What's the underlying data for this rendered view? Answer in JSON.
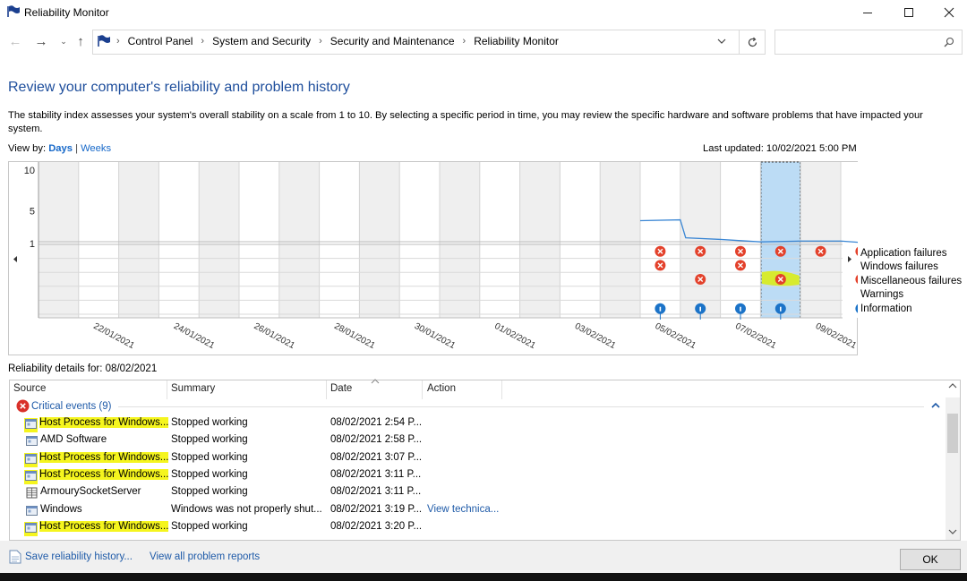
{
  "window": {
    "title": "Reliability Monitor"
  },
  "address": {
    "breadcrumbs": [
      "Control Panel",
      "System and Security",
      "Security and Maintenance",
      "Reliability Monitor"
    ],
    "search_placeholder": ""
  },
  "page": {
    "heading": "Review your computer's reliability and problem history",
    "description": "The stability index assesses your system's overall stability on a scale from 1 to 10. By selecting a specific period in time, you may review the specific hardware and software problems that have impacted your system.",
    "view_by_label": "View by:",
    "view_days": "Days",
    "view_separator": "|",
    "view_weeks": "Weeks",
    "last_updated": "Last updated: 10/02/2021 5:00 PM"
  },
  "chart_data": {
    "type": "line",
    "y_ticks": [
      "10",
      "5",
      "1"
    ],
    "ylim": [
      1,
      10
    ],
    "date_labels": [
      "22/01/2021",
      "24/01/2021",
      "26/01/2021",
      "28/01/2021",
      "30/01/2021",
      "01/02/2021",
      "03/02/2021",
      "05/02/2021",
      "07/02/2021",
      "09/02/2021"
    ],
    "days": [
      "21/01",
      "22/01",
      "23/01",
      "24/01",
      "25/01",
      "26/01",
      "27/01",
      "28/01",
      "29/01",
      "30/01",
      "31/01",
      "01/02",
      "02/02",
      "03/02",
      "04/02",
      "05/02",
      "06/02",
      "07/02",
      "08/02",
      "09/02"
    ],
    "selected_day": "08/02",
    "stability_index": [
      {
        "day": "05/02",
        "value": 3.8
      },
      {
        "day": "06/02",
        "value": 3.9
      },
      {
        "day": "06/02",
        "value": 1.7
      },
      {
        "day": "07/02",
        "value": 1.5
      },
      {
        "day": "08/02",
        "value": 1.2
      },
      {
        "day": "09/02",
        "value": 1.3
      },
      {
        "day": "10/02",
        "value": 1.3
      }
    ],
    "event_rows": [
      "Application failures",
      "Windows failures",
      "Miscellaneous failures",
      "Warnings",
      "Information"
    ],
    "events": {
      "Application failures": [
        "05/02",
        "06/02",
        "07/02",
        "08/02",
        "09/02",
        "10/02"
      ],
      "Windows failures": [
        "05/02",
        "07/02"
      ],
      "Miscellaneous failures": [
        "06/02",
        "08/02",
        "10/02"
      ],
      "Warnings": [],
      "Information": [
        "05/02",
        "06/02",
        "07/02",
        "08/02",
        "10/02"
      ]
    },
    "colors": {
      "line": "#3a86d4",
      "error": "#e3412b",
      "info": "#1b73c8",
      "selected": "#bcdcf5",
      "weekend": "#efefef",
      "highlight": "#d9ec1a"
    }
  },
  "details": {
    "label": "Reliability details for: 08/02/2021",
    "columns": [
      "Source",
      "Summary",
      "Date",
      "Action"
    ],
    "group": "Critical events (9)",
    "rows": [
      {
        "source": "Host Process for Windows...",
        "summary": "Stopped working",
        "date": "08/02/2021 2:54 P...",
        "action": "",
        "icon": "app-window-icon",
        "highlighted": true
      },
      {
        "source": "AMD Software",
        "summary": "Stopped working",
        "date": "08/02/2021 2:58 P...",
        "action": "",
        "icon": "app-window-icon",
        "highlighted": false
      },
      {
        "source": "Host Process for Windows...",
        "summary": "Stopped working",
        "date": "08/02/2021 3:07 P...",
        "action": "",
        "icon": "app-window-icon",
        "highlighted": true
      },
      {
        "source": "Host Process for Windows...",
        "summary": "Stopped working",
        "date": "08/02/2021 3:11 P...",
        "action": "",
        "icon": "app-window-icon",
        "highlighted": true
      },
      {
        "source": "ArmourySocketServer",
        "summary": "Stopped working",
        "date": "08/02/2021 3:11 P...",
        "action": "",
        "icon": "grid-app-icon",
        "highlighted": false
      },
      {
        "source": "Windows",
        "summary": "Windows was not properly shut...",
        "date": "08/02/2021 3:19 P...",
        "action": "View technica...",
        "icon": "app-window-icon",
        "highlighted": false
      },
      {
        "source": "Host Process for Windows...",
        "summary": "Stopped working",
        "date": "08/02/2021 3:20 P...",
        "action": "",
        "icon": "app-window-icon",
        "highlighted": true
      }
    ]
  },
  "footer": {
    "save_link": "Save reliability history...",
    "problems_link": "View all problem reports",
    "ok": "OK"
  }
}
